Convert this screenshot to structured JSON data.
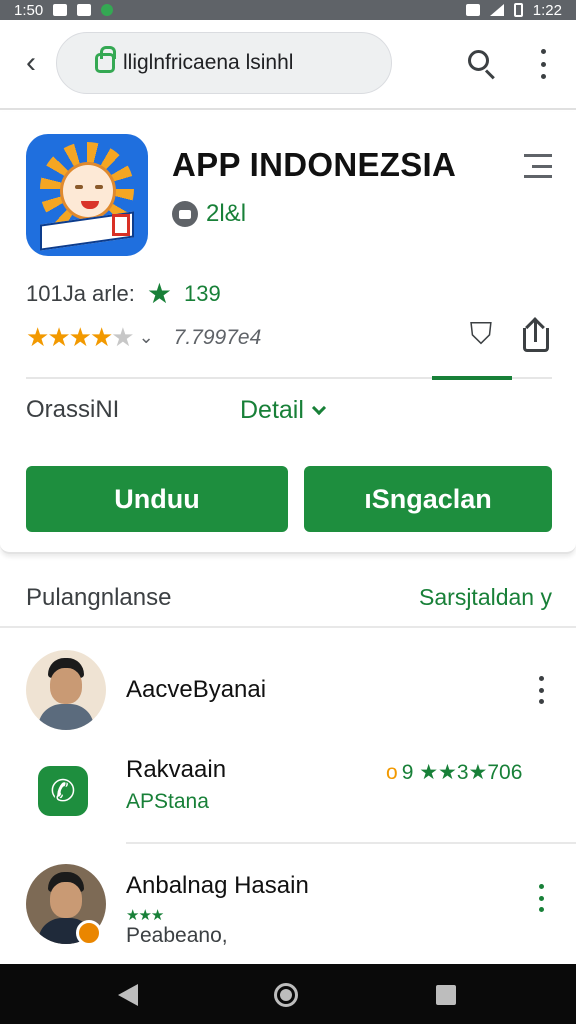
{
  "status_bar": {
    "time_left": "1:50",
    "time_right": "1:22"
  },
  "top_bar": {
    "url_text": "lliglnfricaena lsinhl",
    "back_icon": "chevron-left-icon",
    "search_icon": "search-icon",
    "more_icon": "more-vert-icon"
  },
  "app": {
    "title": "APP INDONEZSIA",
    "developer": "2l&l",
    "meta_label": "101Ja arle:",
    "meta_count": "139",
    "rating_value": 3.5,
    "rating_max": 5,
    "rating_count": "7.7997e4",
    "tab_left": "OrassiNI",
    "tab_detail": "Detail",
    "download_label": "Unduu",
    "share_label": "ıSngaclan",
    "accent_color": "#1e8e3e"
  },
  "reviews": {
    "title": "Pulangnlanse",
    "link": "Sarsjtaldan y",
    "items": [
      {
        "name": "AacveByanai"
      },
      {
        "name": "Rakvaain",
        "sub": "APStana",
        "rating_text": "9 ★★3★706",
        "rating_prefix": "o"
      },
      {
        "name": "Anbalnag Hasain",
        "sub": "Peabeano,"
      }
    ]
  }
}
